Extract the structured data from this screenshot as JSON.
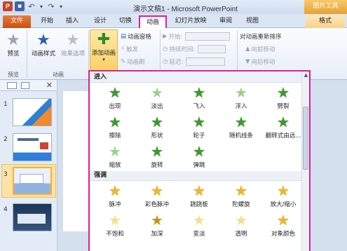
{
  "window": {
    "title": "演示文稿1 - Microsoft PowerPoint",
    "context_title": "图片工具"
  },
  "qat": {
    "app": "P"
  },
  "tabs": {
    "file": "文件",
    "start": "开始",
    "insert": "插入",
    "design": "设计",
    "transitions": "切换",
    "animations": "动画",
    "slideshow": "幻灯片放映",
    "review": "审阅",
    "view": "视图",
    "format": "格式"
  },
  "ribbon": {
    "preview_label": "预览",
    "preview_group": "预览",
    "animation_styles": "动画样式",
    "effect_options": "效果选项",
    "animation_group": "动画",
    "add_animation": "添加动画",
    "animation_pane": "动画窗格",
    "trigger": "触发",
    "animation_painter": "动画刷",
    "start": "开始:",
    "duration": "持续时间:",
    "delay": "延迟:",
    "reorder_title": "对动画重新排序",
    "move_earlier": "向前移动",
    "move_later": "向后移动"
  },
  "slides": [
    {
      "num": "1"
    },
    {
      "num": "2"
    },
    {
      "num": "3"
    },
    {
      "num": "4"
    }
  ],
  "gallery": {
    "entrance_title": "进入",
    "entrance": [
      {
        "label": "出现",
        "style": "green"
      },
      {
        "label": "淡出",
        "style": "green-light"
      },
      {
        "label": "飞入",
        "style": "green"
      },
      {
        "label": "浮入",
        "style": "green-light"
      },
      {
        "label": "劈裂",
        "style": "green"
      },
      {
        "label": "擦除",
        "style": "green"
      },
      {
        "label": "形状",
        "style": "green"
      },
      {
        "label": "轮子",
        "style": "green"
      },
      {
        "label": "随机线条",
        "style": "green"
      },
      {
        "label": "翻转式由远...",
        "style": "green"
      },
      {
        "label": "缩放",
        "style": "green-light"
      },
      {
        "label": "旋转",
        "style": "green"
      },
      {
        "label": "弹跳",
        "style": "green"
      }
    ],
    "emphasis_title": "强调",
    "emphasis": [
      {
        "label": "脉冲",
        "style": "gold"
      },
      {
        "label": "彩色脉冲",
        "style": "gold"
      },
      {
        "label": "跷跷板",
        "style": "gold"
      },
      {
        "label": "陀螺旋",
        "style": "gold"
      },
      {
        "label": "放大/缩小",
        "style": "gold"
      },
      {
        "label": "不饱和",
        "style": "gold-light"
      },
      {
        "label": "加深",
        "style": "gold-dark"
      },
      {
        "label": "变淡",
        "style": "gold-light"
      },
      {
        "label": "透明",
        "style": "gold-light"
      },
      {
        "label": "对象颜色",
        "style": "gold"
      }
    ]
  },
  "colors": {
    "highlight": "#e0199d",
    "file_tab": "#cc5012",
    "accent_gold": "#f9cf63"
  }
}
